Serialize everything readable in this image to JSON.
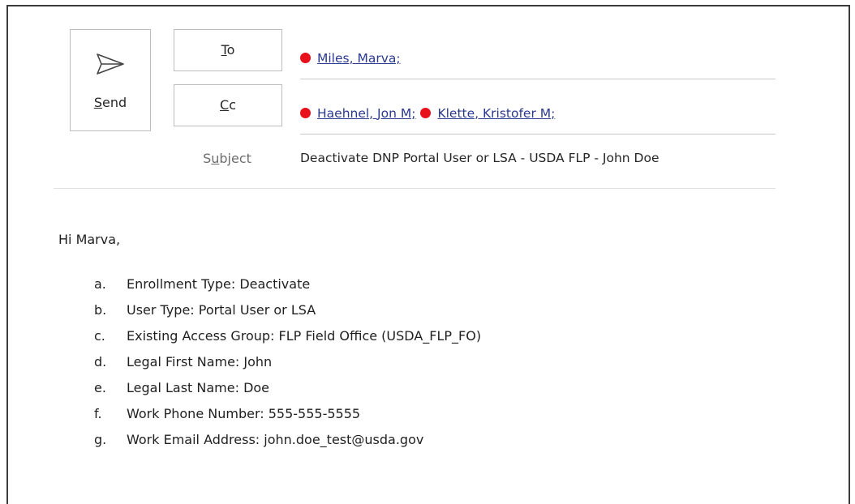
{
  "compose": {
    "send": {
      "label_accel": "S",
      "label_rest": "end"
    },
    "to": {
      "label_accel": "T",
      "label_rest": "o"
    },
    "cc": {
      "label_accel": "C",
      "label_rest": "c"
    },
    "to_recipients": [
      {
        "name": "Miles, Marva;"
      }
    ],
    "cc_recipients": [
      {
        "name": "Haehnel, Jon M;"
      },
      {
        "name": "Klette, Kristofer M;"
      }
    ],
    "subject": {
      "label_pre": "S",
      "label_accel": "u",
      "label_post": "bject",
      "value": "Deactivate DNP Portal User or LSA - USDA FLP - John Doe"
    }
  },
  "body": {
    "greeting": "Hi Marva,",
    "items": [
      {
        "marker": "a.",
        "text": "Enrollment Type: Deactivate"
      },
      {
        "marker": "b.",
        "text": "User Type: Portal User or LSA"
      },
      {
        "marker": "c.",
        "text": "Existing Access Group: FLP Field Office (USDA_FLP_FO)"
      },
      {
        "marker": "d.",
        "text": "Legal First Name: John"
      },
      {
        "marker": "e.",
        "text": "Legal Last Name: Doe"
      },
      {
        "marker": "f.",
        "text": "Work Phone Number: 555-555-5555"
      },
      {
        "marker": "g.",
        "text": "Work Email Address: john.doe_test@usda.gov"
      }
    ]
  },
  "colors": {
    "presence_busy": "#e8101a",
    "link": "#2b3a8f"
  }
}
